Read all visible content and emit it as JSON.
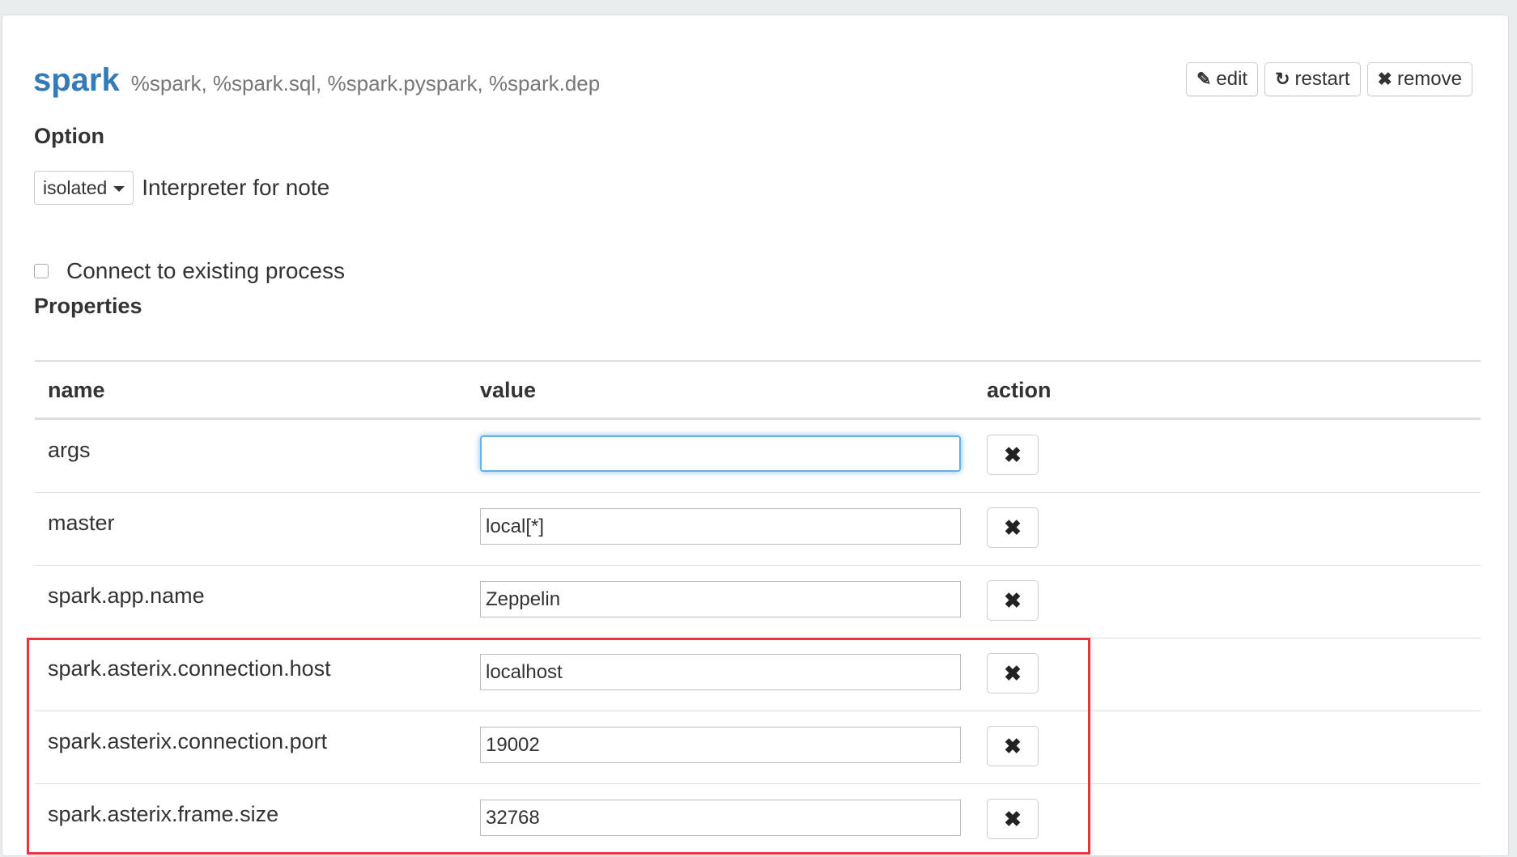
{
  "interpreter": {
    "name": "spark",
    "bindings": "%spark, %spark.sql, %spark.pyspark, %spark.dep"
  },
  "actions": {
    "edit_label": "edit",
    "restart_label": "restart",
    "remove_label": "remove",
    "edit_icon": "✎",
    "restart_icon": "↻",
    "remove_icon": "✖"
  },
  "option": {
    "title": "Option",
    "mode_selected": "isolated",
    "mode_description": "Interpreter for note"
  },
  "connect": {
    "label": "Connect to existing process",
    "checked": false
  },
  "properties": {
    "title": "Properties",
    "columns": [
      "name",
      "value",
      "action"
    ],
    "rows": [
      {
        "name": "args",
        "value": ""
      },
      {
        "name": "master",
        "value": "local[*]"
      },
      {
        "name": "spark.app.name",
        "value": "Zeppelin"
      },
      {
        "name": "spark.asterix.connection.host",
        "value": "localhost"
      },
      {
        "name": "spark.asterix.connection.port",
        "value": "19002"
      },
      {
        "name": "spark.asterix.frame.size",
        "value": "32768"
      }
    ],
    "remove_row_icon": "✖"
  },
  "colors": {
    "accent": "#337ab7",
    "highlight": "#e8343a",
    "focus": "#66afe9"
  }
}
